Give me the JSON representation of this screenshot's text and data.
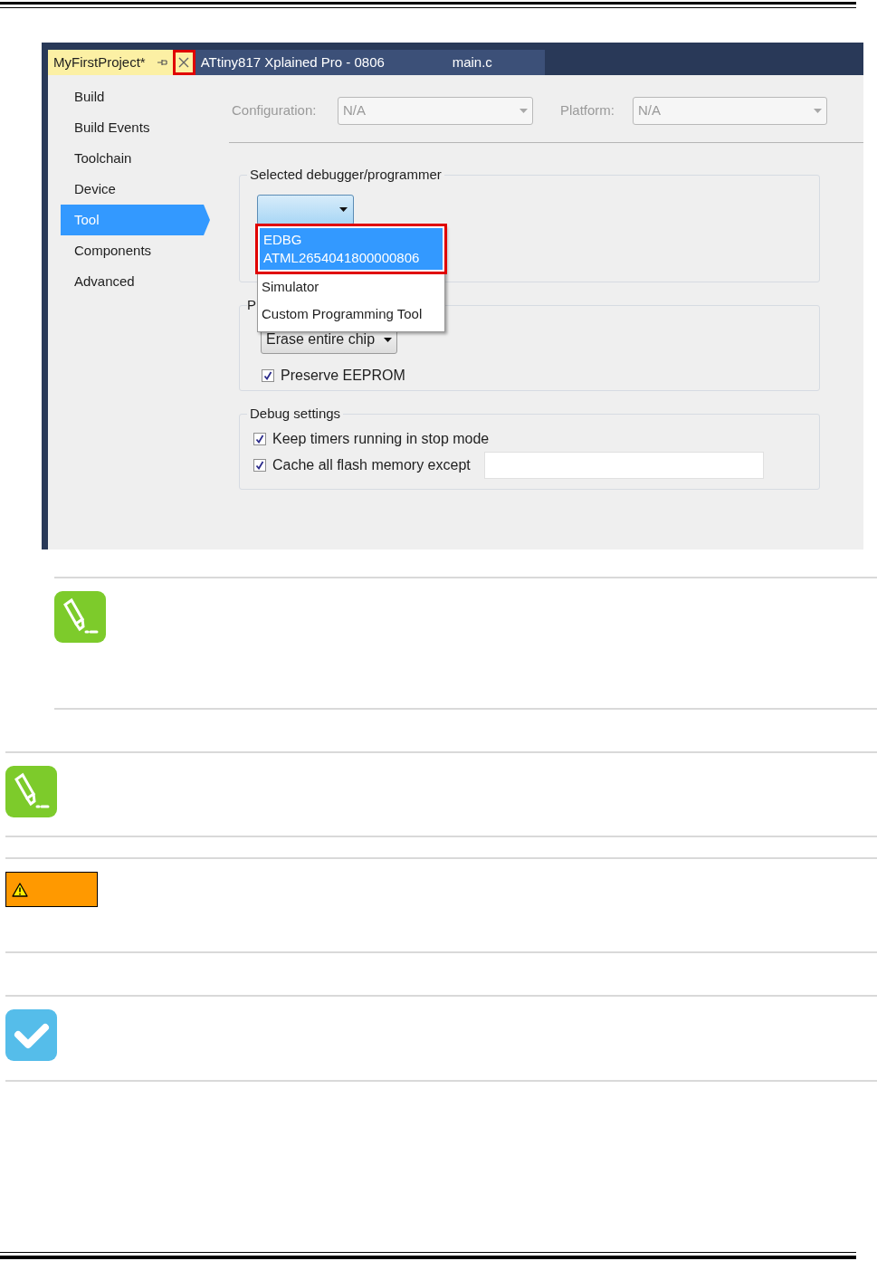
{
  "ide": {
    "tabs": [
      {
        "label": "MyFirstProject*",
        "selected": true,
        "close_highlighted": true
      },
      {
        "label": "ATtiny817 Xplained Pro - 0806",
        "selected": false
      },
      {
        "label": "main.c",
        "selected": false
      }
    ],
    "sidebar": {
      "items": [
        {
          "label": "Build",
          "selected": false
        },
        {
          "label": "Build Events",
          "selected": false
        },
        {
          "label": "Toolchain",
          "selected": false
        },
        {
          "label": "Device",
          "selected": false
        },
        {
          "label": "Tool",
          "selected": true
        },
        {
          "label": "Components",
          "selected": false
        },
        {
          "label": "Advanced",
          "selected": false
        }
      ]
    },
    "configuration": {
      "label": "Configuration:",
      "value": "N/A"
    },
    "platform": {
      "label": "Platform:",
      "value": "N/A"
    },
    "debugger_group": {
      "title": "Selected debugger/programmer",
      "expanded": true,
      "options": [
        {
          "lines": [
            "EDBG",
            "ATML2654041800000806"
          ],
          "selected": true,
          "highlighted": true
        },
        {
          "lines": [
            "Simulator"
          ],
          "selected": false,
          "highlighted": false
        },
        {
          "lines": [
            "Custom Programming Tool"
          ],
          "selected": false,
          "highlighted": false
        }
      ]
    },
    "programming_group": {
      "title": "P",
      "erase_mode": "Erase entire chip",
      "checkboxes": [
        {
          "label": "Preserve EEPROM",
          "checked": true
        }
      ]
    },
    "debug_group": {
      "title": "Debug settings",
      "checkboxes": [
        {
          "label": "Keep timers running in stop mode",
          "checked": true,
          "kind": "plain"
        },
        {
          "label": "Cache all flash memory except",
          "checked": true,
          "kind": "with_field"
        }
      ]
    }
  },
  "callouts": [
    {
      "kind": "note",
      "indented": true
    },
    {
      "kind": "note",
      "indented": false
    },
    {
      "kind": "warning",
      "indented": false
    },
    {
      "kind": "tip",
      "indented": false
    }
  ]
}
